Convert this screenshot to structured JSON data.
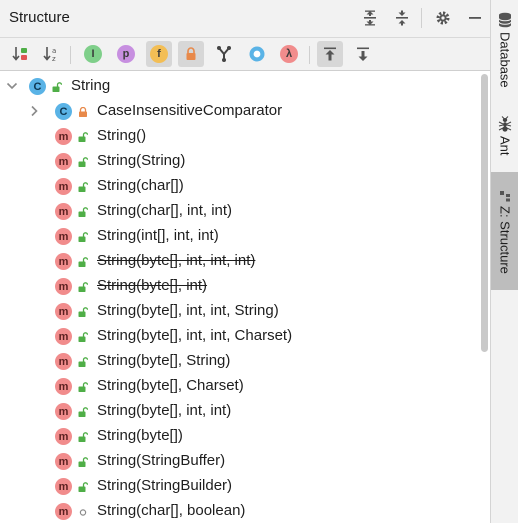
{
  "header": {
    "title": "Structure"
  },
  "toolbar": {
    "buttons": [
      {
        "icon": "sort-by-visibility-icon",
        "pressed": false
      },
      {
        "icon": "sort-alphabetically-icon",
        "pressed": false
      },
      {
        "icon": "show-inherited-icon",
        "pressed": false
      },
      {
        "icon": "show-properties-icon",
        "glyph": "p",
        "pressed": false
      },
      {
        "icon": "show-fields-icon",
        "glyph": "f",
        "pressed": true
      },
      {
        "icon": "show-non-public-icon",
        "pressed": true
      },
      {
        "icon": "show-anonymous-icon",
        "pressed": false
      },
      {
        "icon": "show-toplevel-icon",
        "pressed": false
      },
      {
        "icon": "show-lambdas-icon",
        "glyph": "λ",
        "pressed": false
      },
      {
        "icon": "autoscroll-to-source-icon",
        "pressed": true
      },
      {
        "icon": "autoscroll-from-source-icon",
        "pressed": false
      }
    ]
  },
  "tree": {
    "root": {
      "label": "String",
      "kind": "c"
    },
    "items": [
      {
        "label": "CaseInsensitiveComparator",
        "kind": "c",
        "access": "private",
        "expandable": true,
        "strike": false
      },
      {
        "label": "String()",
        "kind": "m",
        "access": "public",
        "strike": false
      },
      {
        "label": "String(String)",
        "kind": "m",
        "access": "public",
        "strike": false
      },
      {
        "label": "String(char[])",
        "kind": "m",
        "access": "public",
        "strike": false
      },
      {
        "label": "String(char[], int, int)",
        "kind": "m",
        "access": "public",
        "strike": false
      },
      {
        "label": "String(int[], int, int)",
        "kind": "m",
        "access": "public",
        "strike": false
      },
      {
        "label": "String(byte[], int, int, int)",
        "kind": "m",
        "access": "public",
        "strike": true
      },
      {
        "label": "String(byte[], int)",
        "kind": "m",
        "access": "public",
        "strike": true
      },
      {
        "label": "String(byte[], int, int, String)",
        "kind": "m",
        "access": "public",
        "strike": false
      },
      {
        "label": "String(byte[], int, int, Charset)",
        "kind": "m",
        "access": "public",
        "strike": false
      },
      {
        "label": "String(byte[], String)",
        "kind": "m",
        "access": "public",
        "strike": false
      },
      {
        "label": "String(byte[], Charset)",
        "kind": "m",
        "access": "public",
        "strike": false
      },
      {
        "label": "String(byte[], int, int)",
        "kind": "m",
        "access": "public",
        "strike": false
      },
      {
        "label": "String(byte[])",
        "kind": "m",
        "access": "public",
        "strike": false
      },
      {
        "label": "String(StringBuffer)",
        "kind": "m",
        "access": "public",
        "strike": false
      },
      {
        "label": "String(StringBuilder)",
        "kind": "m",
        "access": "public",
        "strike": false
      },
      {
        "label": "String(char[], boolean)",
        "kind": "m",
        "access": "package",
        "strike": false
      }
    ]
  },
  "side_tabs": [
    {
      "label": "Database",
      "icon": "database-icon",
      "active": false
    },
    {
      "label": "Ant",
      "icon": "ant-icon",
      "active": false
    },
    {
      "label": "Z: Structure",
      "icon": "structure-icon",
      "active": true
    }
  ],
  "colors": {
    "method_badge": "#f18c8c",
    "class_badge": "#5ab3e6",
    "public_lock": "#4fae47",
    "private_lock": "#e8894a"
  }
}
